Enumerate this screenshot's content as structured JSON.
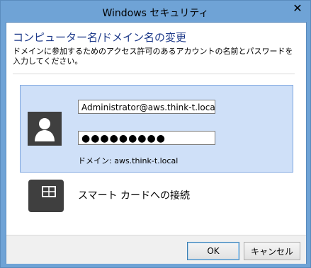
{
  "window": {
    "title": "Windows セキュリティ",
    "close_glyph": "✕"
  },
  "header": {
    "heading": "コンピューター名/ドメイン名の変更",
    "instruction": "ドメインに参加するためのアクセス許可のあるアカウントの名前とパスワードを入力してください。"
  },
  "credentials": {
    "username_value": "Administrator@aws.think-t.local",
    "password_masked": "●●●●●●●●●",
    "domain_label": "ドメイン: aws.think-t.local",
    "avatar_icon": "user-icon"
  },
  "smartcard": {
    "label": "スマート カードへの接続",
    "icon": "smart-card-icon"
  },
  "footer": {
    "ok_label": "OK",
    "cancel_label": "キャンセル"
  },
  "colors": {
    "frame": "#6fa3d6",
    "heading": "#1e3a8a",
    "selection_bg": "#cfe0f8",
    "selection_border": "#7fa7e0",
    "icon_dark": "#3f3f3f"
  }
}
